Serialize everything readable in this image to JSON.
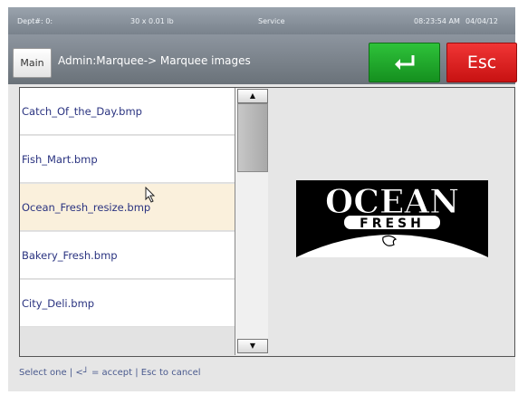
{
  "status_bar": {
    "dept": "Dept#: 0:",
    "weight": "30 x 0.01 lb",
    "mode": "Service",
    "time": "08:23:54 AM",
    "date": "04/04/12"
  },
  "header": {
    "main_label": "Main",
    "title": "Admin:Marquee-> Marquee images",
    "enter_icon": "enter-arrow-icon",
    "esc_label": "Esc"
  },
  "file_list": {
    "items": [
      "Catch_Of_the_Day.bmp",
      "Fish_Mart.bmp",
      "Ocean_Fresh_resize.bmp",
      "Bakery_Fresh.bmp",
      "City_Deli.bmp"
    ],
    "selected_index": 2
  },
  "preview": {
    "logo_word": "OCEAN",
    "logo_banner": "FRESH"
  },
  "footer": {
    "hint": "Select one | <┘ = accept | Esc to cancel"
  },
  "colors": {
    "enter_button": "#1aa524",
    "esc_button": "#e01e1e",
    "selected_row": "#faf0dc",
    "list_text": "#2a3380"
  }
}
